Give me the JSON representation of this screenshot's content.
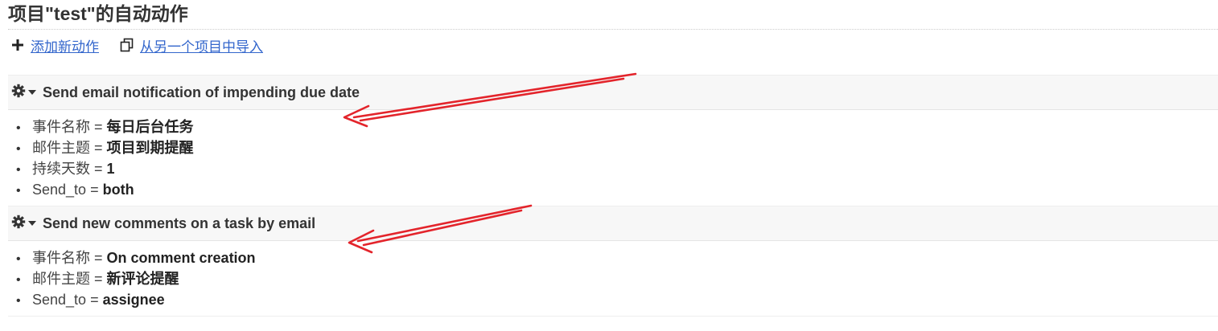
{
  "page": {
    "title": "项目\"test\"的自动动作"
  },
  "toolbar": {
    "add_label": "添加新动作",
    "add_icon": "plus-icon",
    "import_label": "从另一个项目中导入",
    "import_icon": "copy-icon"
  },
  "actions": [
    {
      "title": "Send email notification of impending due date",
      "menu_icon": "gear-icon",
      "params": [
        {
          "key": "事件名称",
          "value": "每日后台任务"
        },
        {
          "key": "邮件主题",
          "value": "项目到期提醒"
        },
        {
          "key": "持续天数",
          "value": "1"
        },
        {
          "key": "Send_to",
          "value": "both"
        }
      ]
    },
    {
      "title": "Send new comments on a task by email",
      "menu_icon": "gear-icon",
      "params": [
        {
          "key": "事件名称",
          "value": "On comment creation"
        },
        {
          "key": "邮件主题",
          "value": "新评论提醒"
        },
        {
          "key": "Send_to",
          "value": "assignee"
        }
      ]
    }
  ],
  "annotations": {
    "arrow_color": "#e3242b"
  },
  "colors": {
    "link": "#3366cc",
    "header_bg": "#f7f7f7"
  }
}
